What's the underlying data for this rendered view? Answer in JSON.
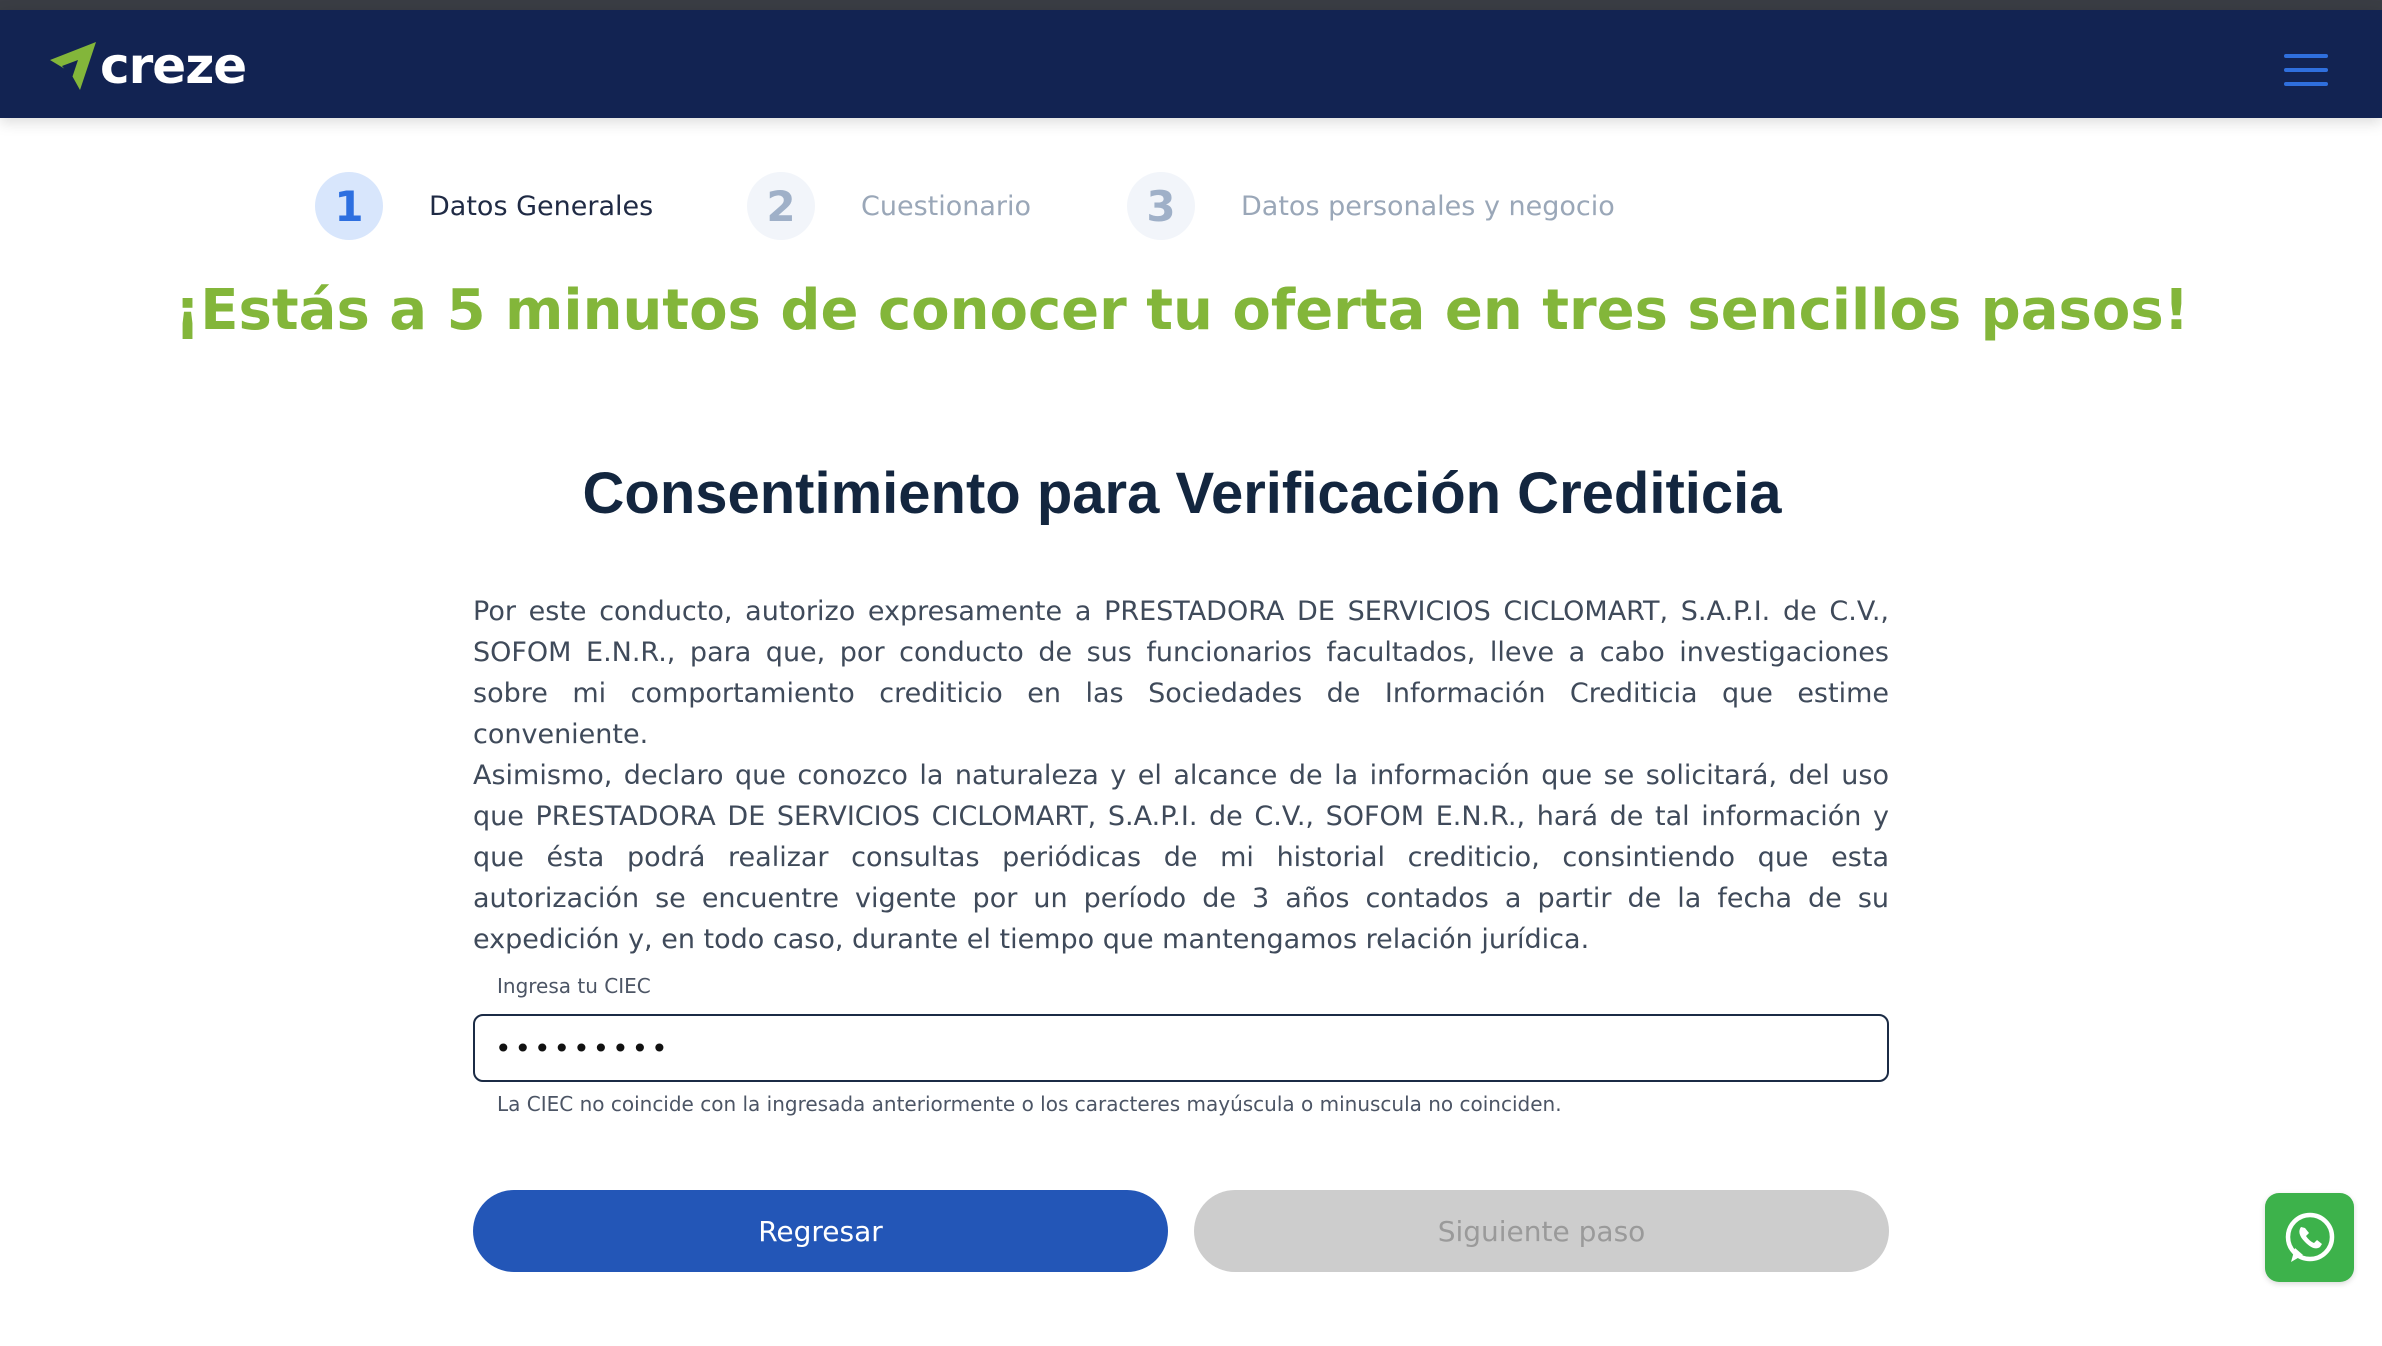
{
  "header": {
    "logo_text": "creze",
    "menu_icon": "hamburger-icon"
  },
  "steps": [
    {
      "number": "1",
      "label": "Datos Generales",
      "state": "active"
    },
    {
      "number": "2",
      "label": "Cuestionario",
      "state": "inactive"
    },
    {
      "number": "3",
      "label": "Datos personales y negocio",
      "state": "inactive"
    }
  ],
  "promo_text": "¡Estás a 5 minutos de conocer tu oferta en tres sencillos pasos!",
  "consent": {
    "title": "Consentimiento para Verificación Crediticia",
    "paragraph1": "Por este conducto, autorizo expresamente a PRESTADORA DE SERVICIOS CICLOMART, S.A.P.I. de C.V., SOFOM E.N.R., para que, por conducto de sus funcionarios facultados, lleve a cabo investigaciones sobre mi comportamiento crediticio en las Sociedades de Información Crediticia que estime conveniente.",
    "paragraph2": "Asimismo, declaro que conozco la naturaleza y el alcance de la información que se solicitará, del uso que PRESTADORA DE SERVICIOS CICLOMART, S.A.P.I. de C.V., SOFOM E.N.R., hará de tal información y que ésta podrá realizar consultas periódicas de mi historial crediticio, consintiendo que esta autorización se encuentre vigente por un período de 3 años contados a partir de la fecha de su expedición y, en todo caso, durante el tiempo que mantengamos relación jurídica."
  },
  "ciec_field": {
    "label": "Ingresa tu CIEC",
    "value": "•••••••••",
    "error": "La CIEC no coincide con la ingresada anteriormente o los caracteres mayúscula o minuscula no coinciden."
  },
  "buttons": {
    "back": "Regresar",
    "next": "Siguiente paso"
  },
  "colors": {
    "navbar": "#122352",
    "brand_green": "#83b63a",
    "primary_blue": "#2356b7",
    "disabled_gray": "#cdcdcd",
    "whatsapp_green": "#3db24b"
  },
  "whatsapp_icon": "whatsapp-icon"
}
